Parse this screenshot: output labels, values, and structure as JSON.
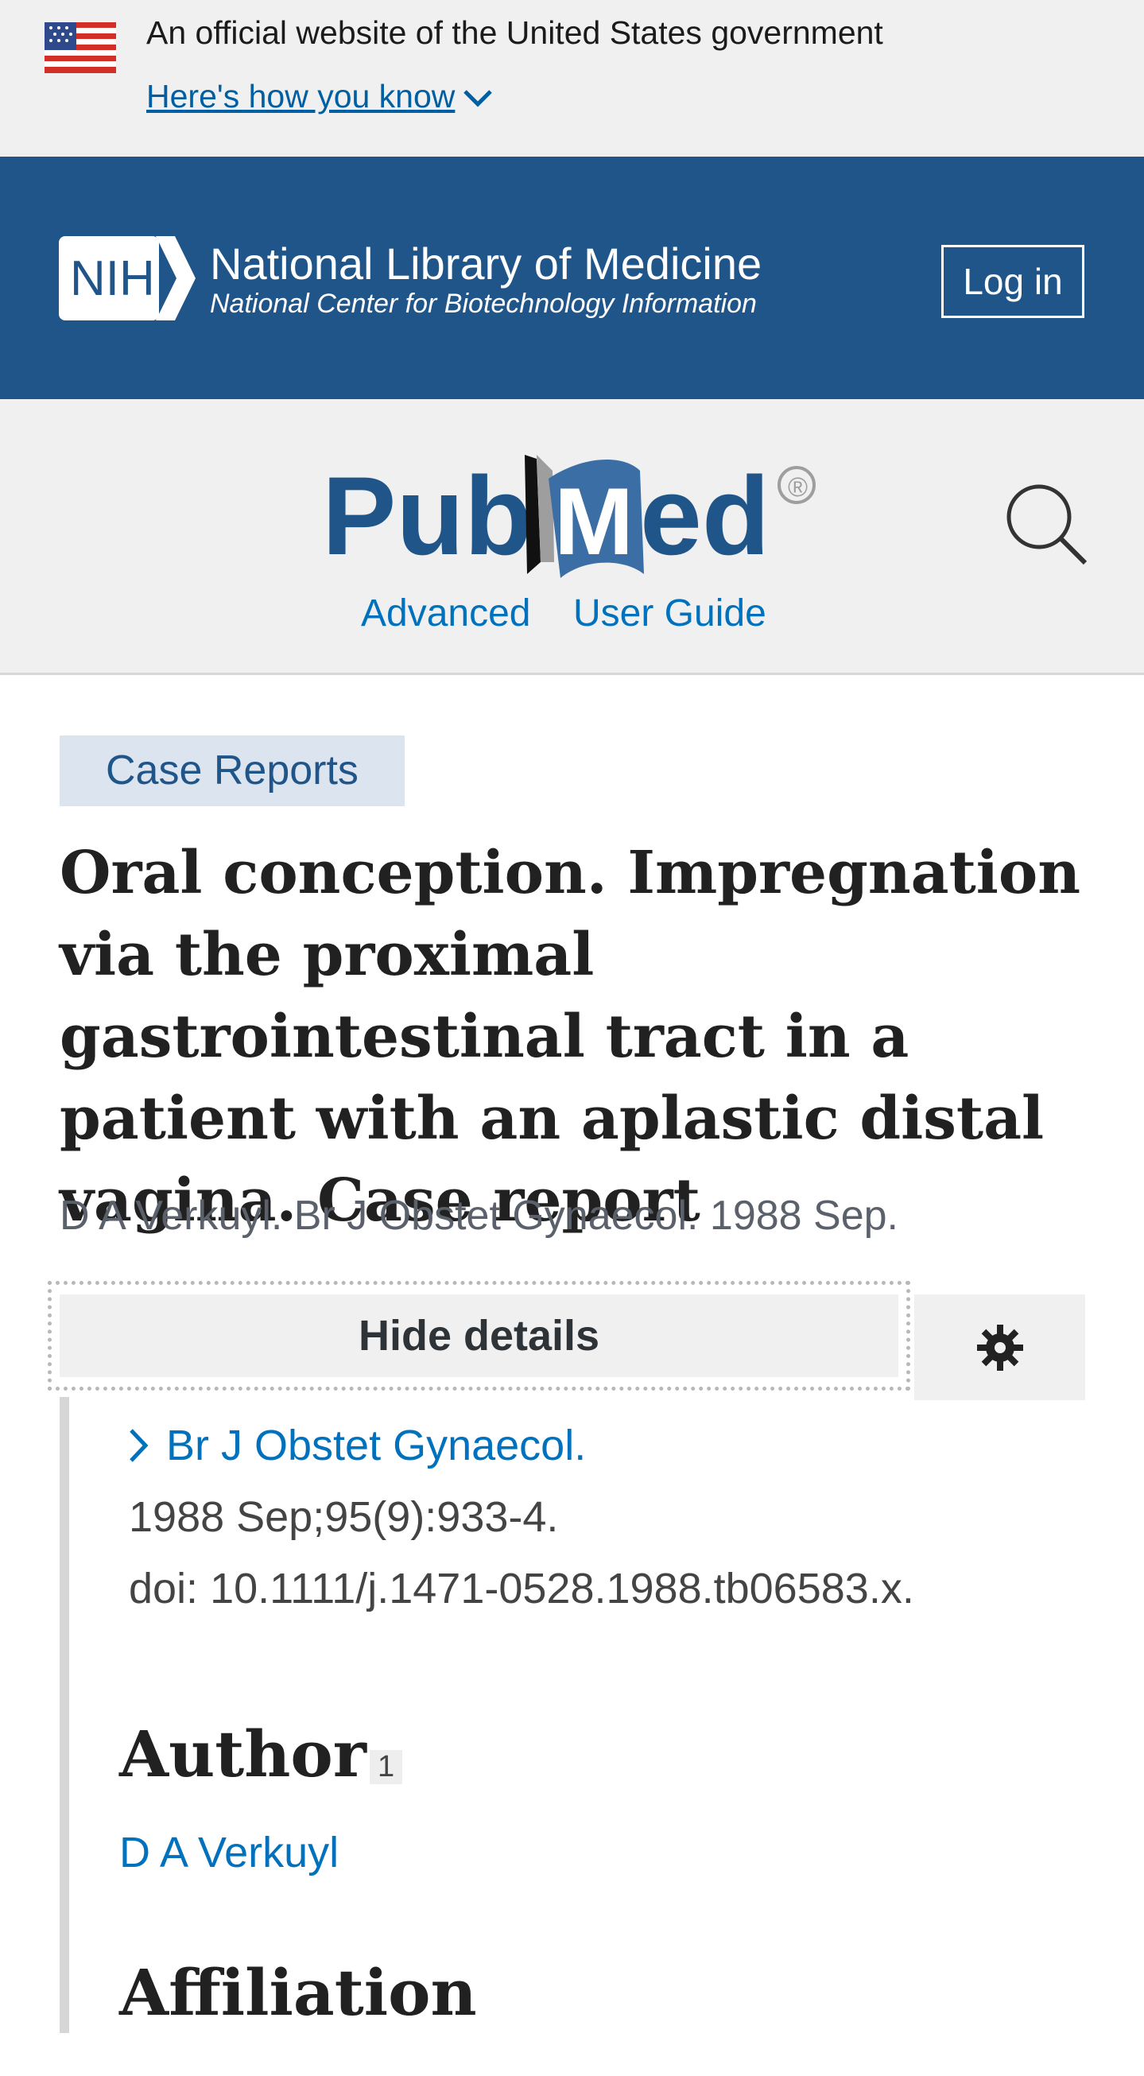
{
  "gov_banner": {
    "text": "An official website of the United States government",
    "link": "Here's how you know"
  },
  "nih_header": {
    "logo_text": "NIH",
    "title": "National Library of Medicine",
    "subtitle": "National Center for Biotechnology Information",
    "login_label": "Log in"
  },
  "pubmed_header": {
    "logo_text": "PubMed",
    "registered": "®",
    "links": [
      "Advanced",
      "User Guide"
    ]
  },
  "article": {
    "type_badge": "Case Reports",
    "title": "Oral conception. Impregnation via the proximal gastrointestinal tract in a patient with an aplastic distal vagina. Case report",
    "citation": "D A Verkuyl. Br J Obstet Gynaecol. 1988 Sep.",
    "hide_details_label": "Hide details",
    "journal": "Br J Obstet Gynaecol.",
    "volume": "1988 Sep;95(9):933-4.",
    "doi": "doi: 10.1111/j.1471-0528.1988.tb06583.x.",
    "author_heading": "Author",
    "author_name": "D A Verkuyl",
    "author_sup": "1",
    "affiliation_heading": "Affiliation"
  },
  "colors": {
    "nih_blue": "#20558a",
    "link_blue": "#0071bc",
    "banner_gray": "#f0f0f0"
  }
}
